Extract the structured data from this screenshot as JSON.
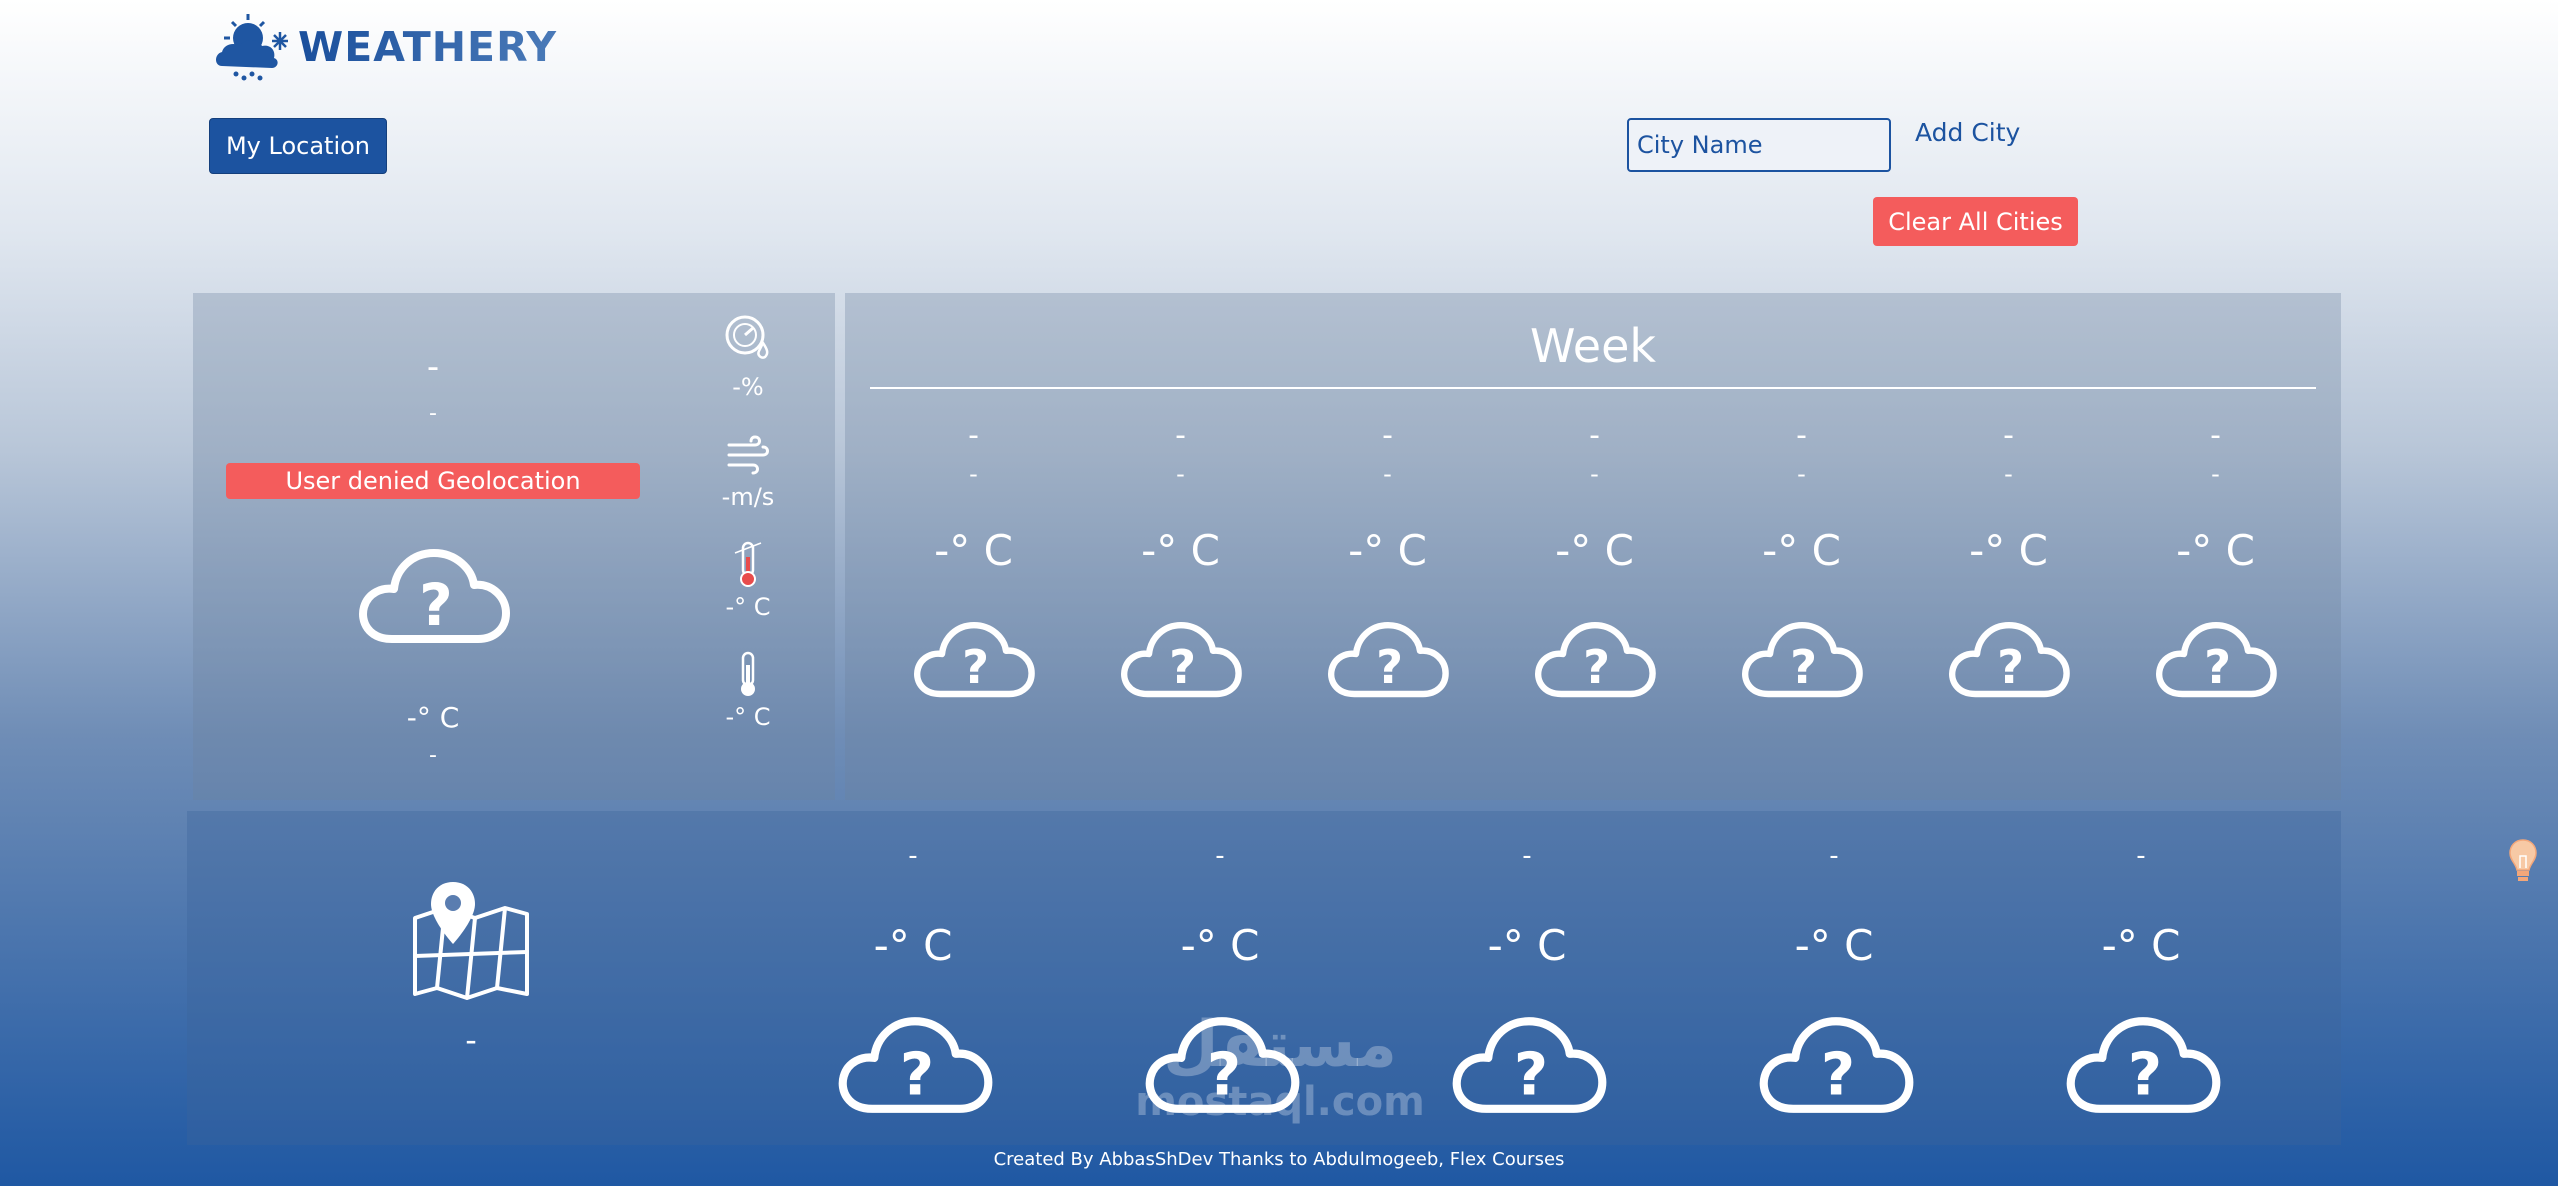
{
  "header": {
    "logo_text": "WEATHERY",
    "my_location_label": "My Location",
    "city_input_placeholder": "City Name",
    "add_city_label": "Add City",
    "clear_all_label": "Clear All Cities"
  },
  "current": {
    "city": "-",
    "description": "-",
    "error": "User denied Geolocation",
    "temp": "-° C",
    "extra": "-",
    "humidity": "-%",
    "wind": "-m/s",
    "temp_max": "-° C",
    "temp_min": "-° C"
  },
  "week": {
    "title": "Week",
    "days": [
      {
        "day": "-",
        "date": "-",
        "temp": "-° C"
      },
      {
        "day": "-",
        "date": "-",
        "temp": "-° C"
      },
      {
        "day": "-",
        "date": "-",
        "temp": "-° C"
      },
      {
        "day": "-",
        "date": "-",
        "temp": "-° C"
      },
      {
        "day": "-",
        "date": "-",
        "temp": "-° C"
      },
      {
        "day": "-",
        "date": "-",
        "temp": "-° C"
      },
      {
        "day": "-",
        "date": "-",
        "temp": "-° C"
      }
    ]
  },
  "hourly": {
    "location": "-",
    "items": [
      {
        "time": "-",
        "temp": "-° C"
      },
      {
        "time": "-",
        "temp": "-° C"
      },
      {
        "time": "-",
        "temp": "-° C"
      },
      {
        "time": "-",
        "temp": "-° C"
      },
      {
        "time": "-",
        "temp": "-° C"
      }
    ]
  },
  "watermark": {
    "arabic": "مستقل",
    "latin": "mostaql.com"
  },
  "footer": "Created By AbbasShDev Thanks to Abdulmogeeb, Flex Courses",
  "colors": {
    "brand": "#1c53a0",
    "danger": "#f45c5c"
  }
}
